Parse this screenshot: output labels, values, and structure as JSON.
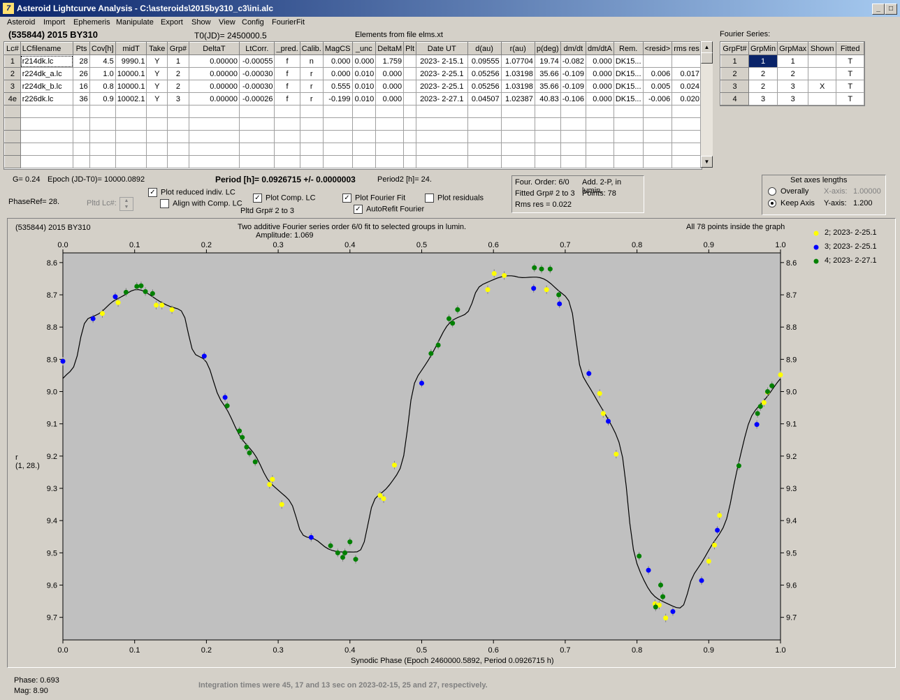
{
  "window": {
    "title": "Asteroid Lightcurve Analysis - C:\\asteroids\\2015by310_c3\\ini.alc",
    "icon": "app-icon"
  },
  "menu": [
    "Asteroid",
    "Import",
    "Ephemeris",
    "Manipulate",
    "Export",
    "Show",
    "View",
    "Config",
    "FourierFit"
  ],
  "header": {
    "object": "(535844) 2015 BY310",
    "t0": "T0(JD)= 2450000.5",
    "elements": "Elements from file elms.xt"
  },
  "lc_table": {
    "columns": [
      "Lc#",
      "LCfilename",
      "Pts",
      "Cov[h]",
      "midT",
      "Take",
      "Grp#",
      "DeltaT",
      "LtCorr.",
      "_pred.",
      "Calib.",
      "MagCS",
      "_unc",
      "DeltaM",
      "Plt",
      "Date UT",
      "d(au)",
      "r(au)",
      "p(deg)",
      "dm/dt",
      "dm/dtA",
      "Rem.",
      "<resid>",
      "rms res"
    ],
    "rows": [
      [
        "1",
        "r214dk.lc",
        "28",
        "4.5",
        "9990.1",
        "Y",
        "1",
        "0.00000",
        "-0.00055",
        "f",
        "n",
        "0.000",
        "0.000",
        "1.759",
        "",
        "2023- 2-15.1",
        "0.09555",
        "1.07704",
        "19.74",
        "-0.082",
        "0.000",
        "DK15...",
        "",
        ""
      ],
      [
        "2",
        "r224dk_a.lc",
        "26",
        "1.0",
        "10000.1",
        "Y",
        "2",
        "0.00000",
        "-0.00030",
        "f",
        "r",
        "0.000",
        "0.010",
        "0.000",
        "",
        "2023- 2-25.1",
        "0.05256",
        "1.03198",
        "35.66",
        "-0.109",
        "0.000",
        "DK15...",
        "0.006",
        "0.017"
      ],
      [
        "3",
        "r224dk_b.lc",
        "16",
        "0.8",
        "10000.1",
        "Y",
        "2",
        "0.00000",
        "-0.00030",
        "f",
        "r",
        "0.555",
        "0.010",
        "0.000",
        "",
        "2023- 2-25.1",
        "0.05256",
        "1.03198",
        "35.66",
        "-0.109",
        "0.000",
        "DK15...",
        "0.005",
        "0.024"
      ],
      [
        "4e",
        "r226dk.lc",
        "36",
        "0.9",
        "10002.1",
        "Y",
        "3",
        "0.00000",
        "-0.00026",
        "f",
        "r",
        "-0.199",
        "0.010",
        "0.000",
        "",
        "2023- 2-27.1",
        "0.04507",
        "1.02387",
        "40.83",
        "-0.106",
        "0.000",
        "DK15...",
        "-0.006",
        "0.020"
      ]
    ]
  },
  "fourier": {
    "title": "Fourier Series:",
    "columns": [
      "GrpFt#",
      "GrpMin",
      "GrpMax",
      "Shown",
      "Fitted"
    ],
    "rows": [
      [
        "1",
        "1",
        "1",
        "",
        "T"
      ],
      [
        "2",
        "2",
        "2",
        "",
        "T"
      ],
      [
        "3",
        "2",
        "3",
        "X",
        "T"
      ],
      [
        "4",
        "3",
        "3",
        "",
        "T"
      ]
    ]
  },
  "params": {
    "g": "G= 0.24",
    "epoch": "Epoch (JD-T0)= 10000.0892",
    "period": "Period [h]= 0.0926715 +/- 0.0000003",
    "period2": "Period2 [h]= 24.",
    "phaseref": "PhaseRef= 28.",
    "pltd_lc": "Pltd Lc#:",
    "plot_reduced": "Plot reduced indiv. LC",
    "align": "Align with Comp. LC",
    "plot_comp": "Plot Comp. LC",
    "pltd_grp": "Pltd Grp#  2   to   3",
    "plot_fourier": "Plot Fourier Fit",
    "autorefit": "AutoRefit Fourier",
    "plot_resid": "Plot residuals",
    "four_order": "Four. Order:  6/0",
    "add": "Add. 2-P, in lumin.",
    "fitted": "Fitted Grp# 2 to 3",
    "points": "Points: 78",
    "rms": "Rms res     = 0.022",
    "axes_title": "Set axes lengths",
    "overally": "Overally",
    "keep": "Keep Axis",
    "xaxis": "X-axis:",
    "xval": "1.00000",
    "yaxis": "Y-axis:",
    "yval": "1.200"
  },
  "plot": {
    "obj": "(535844) 2015 BY310",
    "title": "Two additive Fourier series order 6/0 fit to selected groups in lumin.",
    "amp": "Amplitude: 1.069",
    "inside": "All 78 points inside the graph",
    "ylabel1": "r",
    "ylabel2": "(1, 28.)",
    "xlabel": "Synodic Phase (Epoch 2460000.5892, Period 0.0926715 h)"
  },
  "status": {
    "phase": "Phase:  0.693",
    "mag": "Mag:    8.90",
    "note": "Integration times were 45, 17 and 13 sec on 2023-02-15, 25 and 27, respectively."
  },
  "colors": {
    "yellow": "#ffff00",
    "blue": "#0000ff",
    "green": "#008000",
    "plotbg": "#c0c0c0",
    "selected": "#0a246a"
  },
  "chart_data": {
    "type": "scatter",
    "xlim": [
      0.0,
      1.0
    ],
    "ylim": [
      9.77,
      8.57
    ],
    "xticks": [
      0.0,
      0.1,
      0.2,
      0.3,
      0.4,
      0.5,
      0.6,
      0.7,
      0.8,
      0.9,
      1.0
    ],
    "yticks": [
      8.6,
      8.7,
      8.8,
      8.9,
      9.0,
      9.1,
      9.2,
      9.3,
      9.4,
      9.5,
      9.6,
      9.7
    ],
    "series": [
      {
        "name": "2; 2023- 2-25.1",
        "color": "#ffff00",
        "points": [
          [
            0.055,
            8.758
          ],
          [
            0.077,
            8.724
          ],
          [
            0.13,
            8.732
          ],
          [
            0.138,
            8.732
          ],
          [
            0.152,
            8.746
          ],
          [
            0.288,
            9.288
          ],
          [
            0.292,
            9.272
          ],
          [
            0.305,
            9.35
          ],
          [
            0.442,
            9.322
          ],
          [
            0.447,
            9.332
          ],
          [
            0.462,
            9.228
          ],
          [
            0.592,
            8.684
          ],
          [
            0.601,
            8.634
          ],
          [
            0.615,
            8.64
          ],
          [
            0.674,
            8.684
          ],
          [
            0.748,
            9.006
          ],
          [
            0.753,
            9.068
          ],
          [
            0.771,
            9.194
          ],
          [
            0.825,
            9.658
          ],
          [
            0.831,
            9.662
          ],
          [
            0.84,
            9.702
          ],
          [
            0.9,
            9.526
          ],
          [
            0.908,
            9.476
          ],
          [
            0.915,
            9.384
          ],
          [
            0.977,
            9.034
          ],
          [
            0.982,
            9.002
          ],
          [
            1.0,
            8.948
          ]
        ]
      },
      {
        "name": "3; 2023- 2-25.1",
        "color": "#0000ff",
        "points": [
          [
            0.0,
            8.906
          ],
          [
            0.042,
            8.774
          ],
          [
            0.073,
            8.706
          ],
          [
            0.197,
            8.89
          ],
          [
            0.226,
            9.018
          ],
          [
            0.346,
            9.452
          ],
          [
            0.5,
            8.974
          ],
          [
            0.656,
            8.68
          ],
          [
            0.692,
            8.728
          ],
          [
            0.733,
            8.944
          ],
          [
            0.76,
            9.092
          ],
          [
            0.816,
            9.554
          ],
          [
            0.85,
            9.682
          ],
          [
            0.89,
            9.586
          ],
          [
            0.912,
            9.43
          ],
          [
            0.967,
            9.102
          ]
        ]
      },
      {
        "name": "4; 2023- 2-27.1",
        "color": "#008000",
        "points": [
          [
            0.088,
            8.692
          ],
          [
            0.103,
            8.674
          ],
          [
            0.109,
            8.672
          ],
          [
            0.115,
            8.69
          ],
          [
            0.125,
            8.696
          ],
          [
            0.229,
            9.044
          ],
          [
            0.246,
            9.122
          ],
          [
            0.25,
            9.142
          ],
          [
            0.256,
            9.172
          ],
          [
            0.26,
            9.19
          ],
          [
            0.268,
            9.218
          ],
          [
            0.373,
            9.478
          ],
          [
            0.383,
            9.5
          ],
          [
            0.39,
            9.514
          ],
          [
            0.393,
            9.5
          ],
          [
            0.4,
            9.466
          ],
          [
            0.408,
            9.52
          ],
          [
            0.513,
            8.882
          ],
          [
            0.523,
            8.856
          ],
          [
            0.538,
            8.774
          ],
          [
            0.543,
            8.788
          ],
          [
            0.55,
            8.746
          ],
          [
            0.657,
            8.616
          ],
          [
            0.667,
            8.62
          ],
          [
            0.679,
            8.62
          ],
          [
            0.691,
            8.7
          ],
          [
            0.803,
            9.51
          ],
          [
            0.826,
            9.668
          ],
          [
            0.833,
            9.6
          ],
          [
            0.836,
            9.636
          ],
          [
            0.942,
            9.23
          ],
          [
            0.968,
            9.068
          ],
          [
            0.972,
            9.046
          ],
          [
            0.982,
            9.0
          ],
          [
            0.988,
            8.982
          ]
        ]
      }
    ],
    "legend_position": "right"
  }
}
